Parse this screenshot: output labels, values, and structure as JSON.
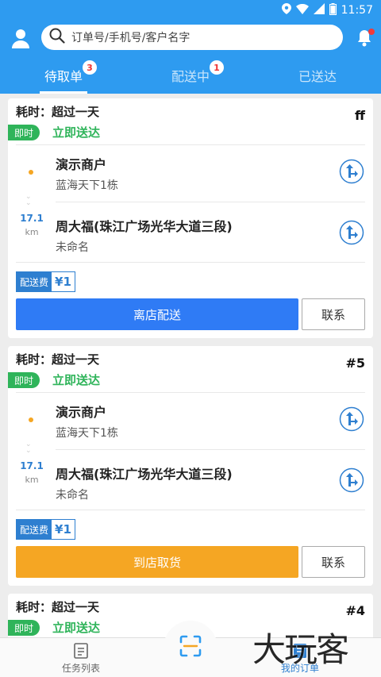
{
  "status_bar": {
    "time": "11:57"
  },
  "search": {
    "placeholder": "订单号/手机号/客户名字"
  },
  "tabs": [
    {
      "label": "待取单",
      "badge": "3",
      "active": true
    },
    {
      "label": "配送中",
      "badge": "1",
      "active": false
    },
    {
      "label": "已送达",
      "badge": "",
      "active": false
    }
  ],
  "orders": [
    {
      "duration": "耗时：超过一天",
      "number": "ff",
      "tag": "即时",
      "delivery_type": "立即送达",
      "pickup": {
        "name": "演示商户",
        "address": "蓝海天下1栋"
      },
      "dropoff": {
        "name": "周大福(珠江广场光华大道三段)",
        "address": "未命名"
      },
      "distance": "17.1",
      "distance_unit": "km",
      "fee_label": "配送费",
      "fee": "¥1",
      "action": "离店配送",
      "action_color": "#2f7bf5",
      "contact": "联系"
    },
    {
      "duration": "耗时：超过一天",
      "number": "#5",
      "tag": "即时",
      "delivery_type": "立即送达",
      "pickup": {
        "name": "演示商户",
        "address": "蓝海天下1栋"
      },
      "dropoff": {
        "name": "周大福(珠江广场光华大道三段)",
        "address": "未命名"
      },
      "distance": "17.1",
      "distance_unit": "km",
      "fee_label": "配送费",
      "fee": "¥1",
      "action": "到店取货",
      "action_color": "#f5a623",
      "contact": "联系"
    },
    {
      "duration": "耗时：超过一天",
      "number": "#4",
      "tag": "即时",
      "delivery_type": "立即送达"
    }
  ],
  "bottom_nav": {
    "left": "任务列表",
    "right": "我的订单"
  },
  "watermark": "大玩客",
  "colors": {
    "primary": "#2e9bf0",
    "green": "#2fb45a",
    "orange": "#f5a623",
    "blue_btn": "#2f7bf5"
  }
}
